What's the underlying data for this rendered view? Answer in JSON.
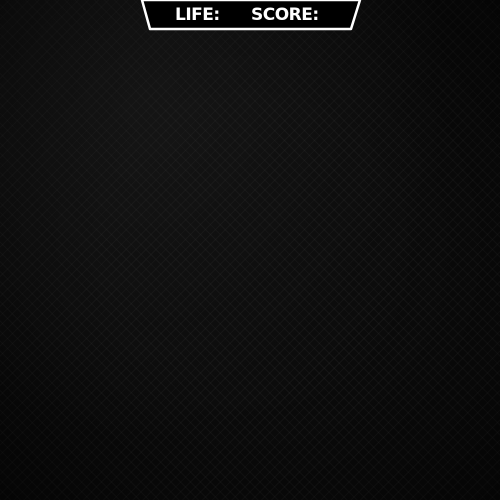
{
  "hud": {
    "life_label": "LIFE:",
    "score_label": "SCORE:"
  },
  "colors": {
    "background": "#0b0b0b",
    "hud_fill": "#000000",
    "hud_border": "#ffffff",
    "hud_text": "#ffffff"
  }
}
